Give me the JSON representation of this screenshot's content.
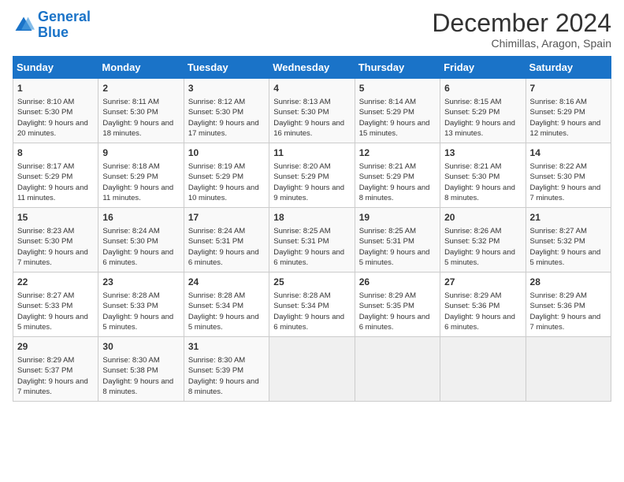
{
  "logo": {
    "line1": "General",
    "line2": "Blue"
  },
  "title": "December 2024",
  "location": "Chimillas, Aragon, Spain",
  "days_of_week": [
    "Sunday",
    "Monday",
    "Tuesday",
    "Wednesday",
    "Thursday",
    "Friday",
    "Saturday"
  ],
  "weeks": [
    [
      {
        "day": "1",
        "sunrise": "8:10 AM",
        "sunset": "5:30 PM",
        "daylight": "9 hours and 20 minutes."
      },
      {
        "day": "2",
        "sunrise": "8:11 AM",
        "sunset": "5:30 PM",
        "daylight": "9 hours and 18 minutes."
      },
      {
        "day": "3",
        "sunrise": "8:12 AM",
        "sunset": "5:30 PM",
        "daylight": "9 hours and 17 minutes."
      },
      {
        "day": "4",
        "sunrise": "8:13 AM",
        "sunset": "5:30 PM",
        "daylight": "9 hours and 16 minutes."
      },
      {
        "day": "5",
        "sunrise": "8:14 AM",
        "sunset": "5:29 PM",
        "daylight": "9 hours and 15 minutes."
      },
      {
        "day": "6",
        "sunrise": "8:15 AM",
        "sunset": "5:29 PM",
        "daylight": "9 hours and 13 minutes."
      },
      {
        "day": "7",
        "sunrise": "8:16 AM",
        "sunset": "5:29 PM",
        "daylight": "9 hours and 12 minutes."
      }
    ],
    [
      {
        "day": "8",
        "sunrise": "8:17 AM",
        "sunset": "5:29 PM",
        "daylight": "9 hours and 11 minutes."
      },
      {
        "day": "9",
        "sunrise": "8:18 AM",
        "sunset": "5:29 PM",
        "daylight": "9 hours and 11 minutes."
      },
      {
        "day": "10",
        "sunrise": "8:19 AM",
        "sunset": "5:29 PM",
        "daylight": "9 hours and 10 minutes."
      },
      {
        "day": "11",
        "sunrise": "8:20 AM",
        "sunset": "5:29 PM",
        "daylight": "9 hours and 9 minutes."
      },
      {
        "day": "12",
        "sunrise": "8:21 AM",
        "sunset": "5:29 PM",
        "daylight": "9 hours and 8 minutes."
      },
      {
        "day": "13",
        "sunrise": "8:21 AM",
        "sunset": "5:30 PM",
        "daylight": "9 hours and 8 minutes."
      },
      {
        "day": "14",
        "sunrise": "8:22 AM",
        "sunset": "5:30 PM",
        "daylight": "9 hours and 7 minutes."
      }
    ],
    [
      {
        "day": "15",
        "sunrise": "8:23 AM",
        "sunset": "5:30 PM",
        "daylight": "9 hours and 7 minutes."
      },
      {
        "day": "16",
        "sunrise": "8:24 AM",
        "sunset": "5:30 PM",
        "daylight": "9 hours and 6 minutes."
      },
      {
        "day": "17",
        "sunrise": "8:24 AM",
        "sunset": "5:31 PM",
        "daylight": "9 hours and 6 minutes."
      },
      {
        "day": "18",
        "sunrise": "8:25 AM",
        "sunset": "5:31 PM",
        "daylight": "9 hours and 6 minutes."
      },
      {
        "day": "19",
        "sunrise": "8:25 AM",
        "sunset": "5:31 PM",
        "daylight": "9 hours and 5 minutes."
      },
      {
        "day": "20",
        "sunrise": "8:26 AM",
        "sunset": "5:32 PM",
        "daylight": "9 hours and 5 minutes."
      },
      {
        "day": "21",
        "sunrise": "8:27 AM",
        "sunset": "5:32 PM",
        "daylight": "9 hours and 5 minutes."
      }
    ],
    [
      {
        "day": "22",
        "sunrise": "8:27 AM",
        "sunset": "5:33 PM",
        "daylight": "9 hours and 5 minutes."
      },
      {
        "day": "23",
        "sunrise": "8:28 AM",
        "sunset": "5:33 PM",
        "daylight": "9 hours and 5 minutes."
      },
      {
        "day": "24",
        "sunrise": "8:28 AM",
        "sunset": "5:34 PM",
        "daylight": "9 hours and 5 minutes."
      },
      {
        "day": "25",
        "sunrise": "8:28 AM",
        "sunset": "5:34 PM",
        "daylight": "9 hours and 6 minutes."
      },
      {
        "day": "26",
        "sunrise": "8:29 AM",
        "sunset": "5:35 PM",
        "daylight": "9 hours and 6 minutes."
      },
      {
        "day": "27",
        "sunrise": "8:29 AM",
        "sunset": "5:36 PM",
        "daylight": "9 hours and 6 minutes."
      },
      {
        "day": "28",
        "sunrise": "8:29 AM",
        "sunset": "5:36 PM",
        "daylight": "9 hours and 7 minutes."
      }
    ],
    [
      {
        "day": "29",
        "sunrise": "8:29 AM",
        "sunset": "5:37 PM",
        "daylight": "9 hours and 7 minutes."
      },
      {
        "day": "30",
        "sunrise": "8:30 AM",
        "sunset": "5:38 PM",
        "daylight": "9 hours and 8 minutes."
      },
      {
        "day": "31",
        "sunrise": "8:30 AM",
        "sunset": "5:39 PM",
        "daylight": "9 hours and 8 minutes."
      },
      null,
      null,
      null,
      null
    ]
  ]
}
